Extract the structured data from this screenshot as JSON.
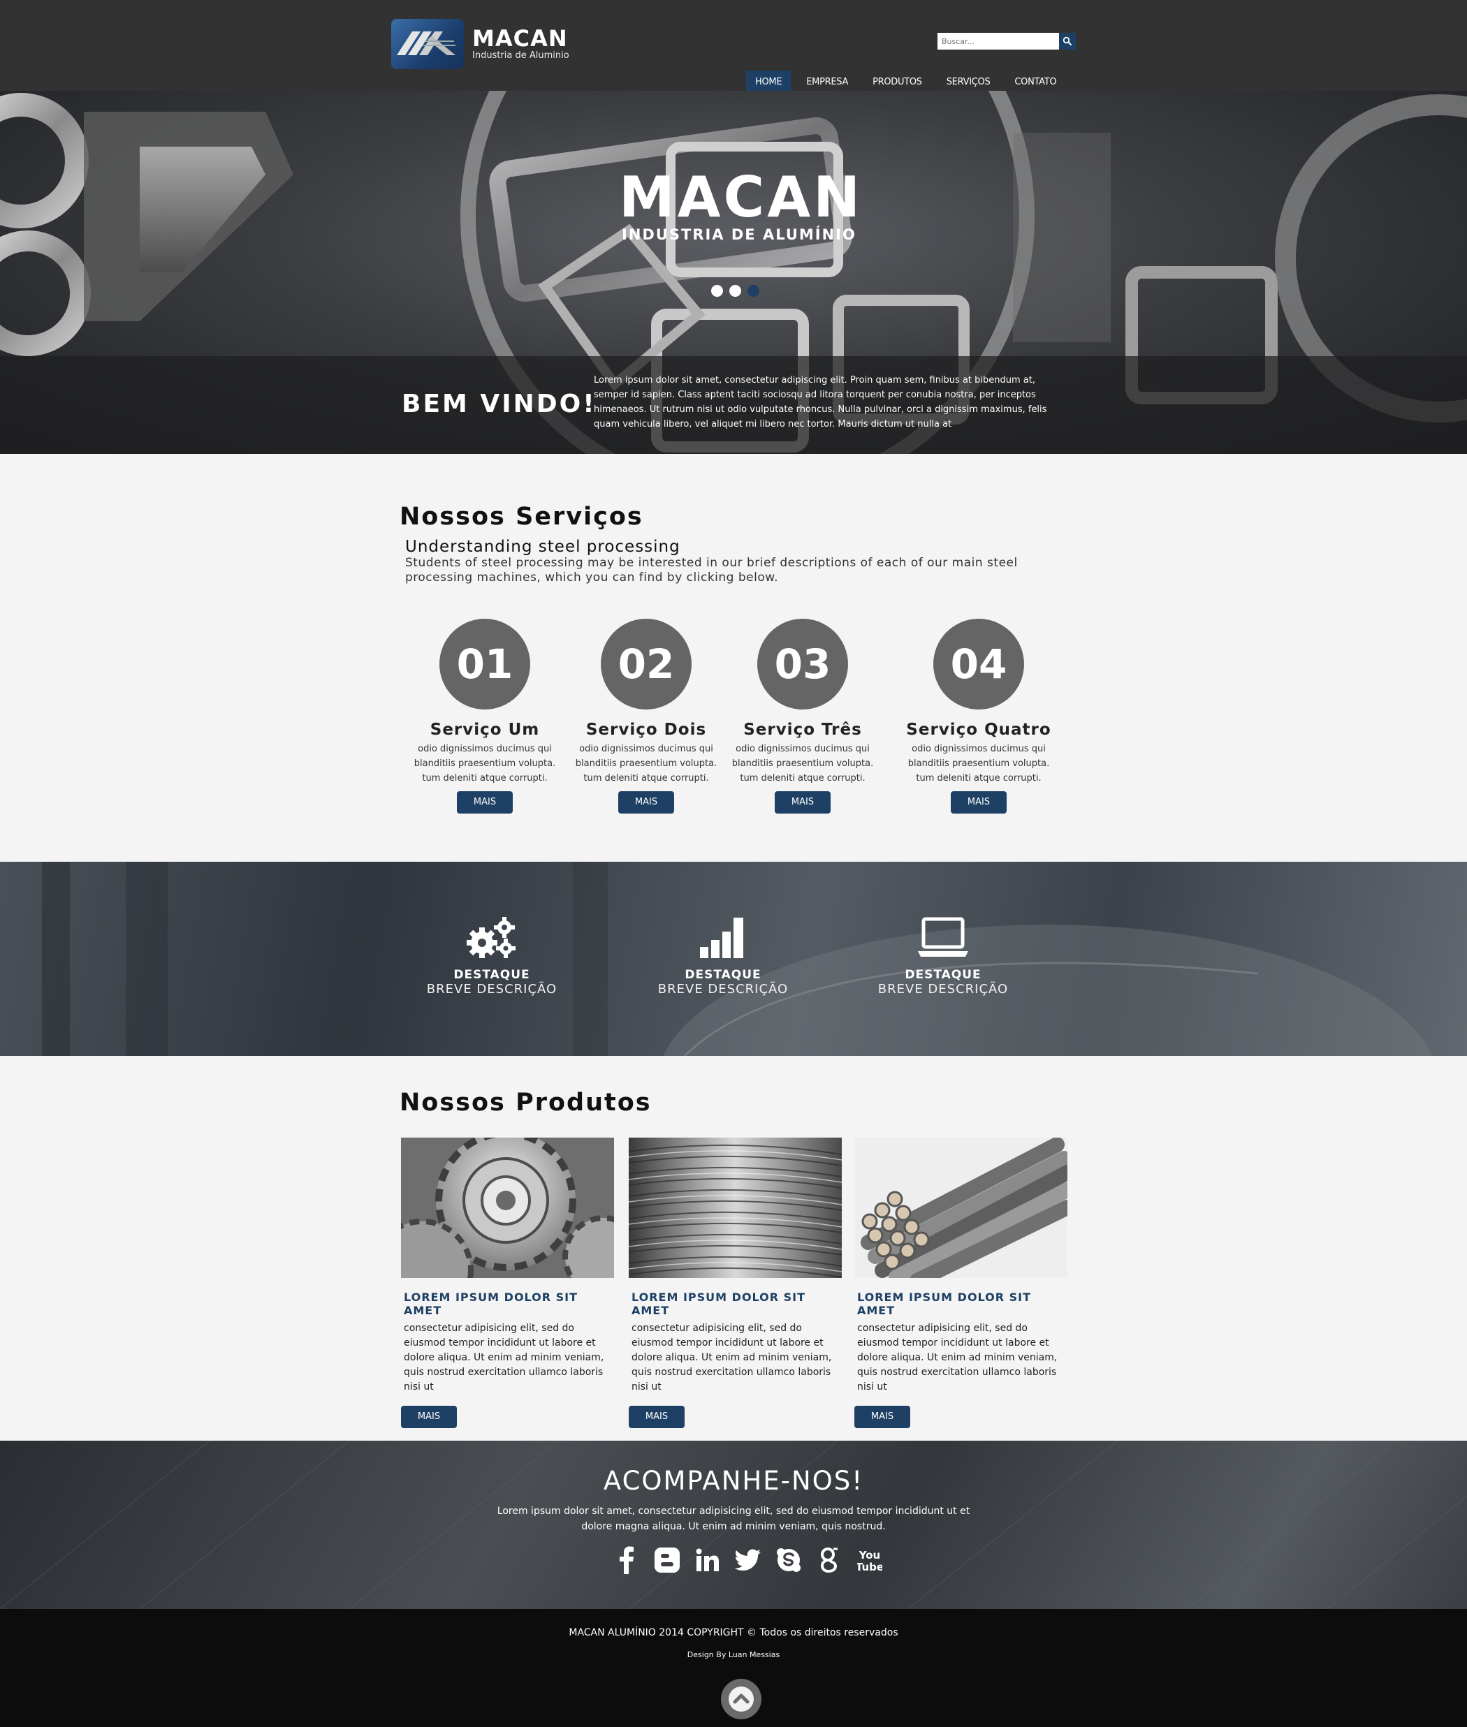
{
  "header": {
    "logo_name": "MACAN",
    "logo_tagline": "Industria de Aluminio",
    "search_placeholder": "Buscar...",
    "nav": [
      "HOME",
      "EMPRESA",
      "PRODUTOS",
      "SERVIÇOS",
      "CONTATO"
    ],
    "active_nav": "HOME"
  },
  "hero": {
    "title": "MACAN",
    "subtitle": "INDUSTRIA DE ALUMÍNIO",
    "slides": 3,
    "active_slide": 3,
    "welcome_title": "BEM VINDO!",
    "welcome_text": "Lorem ipsum dolor sit amet, consectetur adipiscing elit. Proin quam sem, finibus at bibendum at, semper id sapien. Class aptent taciti sociosqu ad litora torquent per conubia nostra, per inceptos himenaeos. Ut rutrum nisi ut odio vulputate rhoncus. Nulla pulvinar, orci a dignissim maximus, felis quam vehicula libero, vel aliquet mi libero nec tortor. Mauris dictum ut nulla at"
  },
  "services": {
    "title": "Nossos Serviços",
    "subtitle": "Understanding steel processing",
    "description": "Students of steel processing may be interested in our brief descriptions of each of our main steel processing machines, which you can find by clicking below.",
    "items": [
      {
        "number": "01",
        "name": "Serviço Um",
        "text": "odio dignissimos ducimus qui blanditiis praesentium volupta. tum deleniti atque corrupti.",
        "button": "MAIS"
      },
      {
        "number": "02",
        "name": "Serviço Dois",
        "text": "odio dignissimos ducimus qui blanditiis praesentium volupta. tum deleniti atque corrupti.",
        "button": "MAIS"
      },
      {
        "number": "03",
        "name": "Serviço Três",
        "text": "odio dignissimos ducimus qui blanditiis praesentium volupta. tum deleniti atque corrupti.",
        "button": "MAIS"
      },
      {
        "number": "04",
        "name": "Serviço Quatro",
        "text": "odio dignissimos ducimus qui blanditiis praesentium volupta. tum deleniti atque corrupti.",
        "button": "MAIS"
      }
    ]
  },
  "features": [
    {
      "icon": "gears-icon",
      "title": "DESTAQUE",
      "desc": "BREVE DESCRIÇÃO"
    },
    {
      "icon": "bar-chart-icon",
      "title": "DESTAQUE",
      "desc": "BREVE DESCRIÇÃO"
    },
    {
      "icon": "laptop-icon",
      "title": "DESTAQUE",
      "desc": "BREVE DESCRIÇÃO"
    }
  ],
  "products": {
    "title": "Nossos Produtos",
    "items": [
      {
        "image": "gears-photo",
        "title": "LOREM IPSUM DOLOR SIT AMET",
        "text": "consectetur adipisicing elit, sed do eiusmod tempor incididunt ut labore et dolore aliqua. Ut enim ad minim veniam, quis nostrud exercitation ullamco laboris nisi ut",
        "button": "MAIS"
      },
      {
        "image": "wire-coil-photo",
        "title": "LOREM IPSUM DOLOR SIT AMET",
        "text": "consectetur adipisicing elit, sed do eiusmod tempor incididunt ut labore et dolore aliqua. Ut enim ad minim veniam, quis nostrud exercitation ullamco laboris nisi ut",
        "button": "MAIS"
      },
      {
        "image": "pipes-photo",
        "title": "LOREM IPSUM DOLOR SIT AMET",
        "text": "consectetur adipisicing elit, sed do eiusmod tempor incididunt ut labore et dolore aliqua. Ut enim ad minim veniam, quis nostrud exercitation ullamco laboris nisi ut",
        "button": "MAIS"
      }
    ]
  },
  "follow": {
    "title": "ACOMPANHE-NOS!",
    "text": "Lorem ipsum dolor sit amet, consectetur adipisicing elit, sed do eiusmod tempor incididunt ut et dolore magna aliqua. Ut enim ad minim veniam, quis nostrud.",
    "socials": [
      "facebook-icon",
      "blogger-icon",
      "linkedin-icon",
      "twitter-icon",
      "skype-icon",
      "google-icon",
      "youtube-icon"
    ]
  },
  "footer": {
    "copyright": "MACAN ALUMÍNIO 2014 COPYRIGHT © Todos os direitos reservados",
    "credit": "Design By Luan Messias"
  },
  "colors": {
    "header_bg": "#323232",
    "accent": "#1e4064",
    "circle": "#656565",
    "footer_bg": "#0c0c0c"
  }
}
